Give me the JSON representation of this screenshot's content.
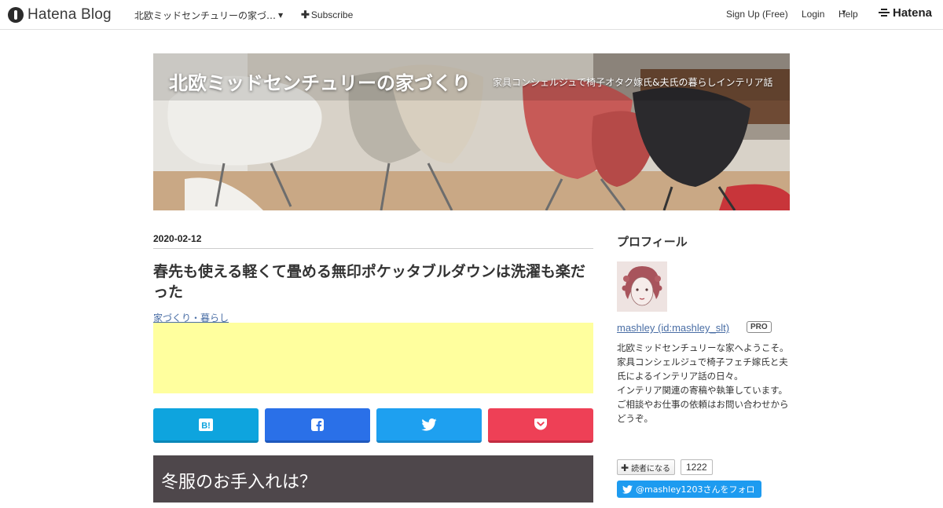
{
  "topbar": {
    "brand": "Hatena Blog",
    "blog_dropdown": "北欧ミッドセンチュリーの家づ…",
    "subscribe": "Subscribe",
    "sign_up": "Sign Up (Free)",
    "login": "Login",
    "help": "Help",
    "hatena": "Hatena"
  },
  "header": {
    "title": "北欧ミッドセンチュリーの家づくり",
    "description": "家具コンシェルジュで椅子オタク嫁氏&夫氏の暮らしインテリア話"
  },
  "entry": {
    "date": "2020-02-12",
    "title": "春先も使える軽くて畳める無印ポケッタブルダウンは洗濯も楽だった",
    "category": "家づくり・暮らし",
    "share_buttons": [
      {
        "name": "hatena-bookmark",
        "icon": "B!"
      },
      {
        "name": "facebook",
        "icon": "facebook-icon"
      },
      {
        "name": "twitter",
        "icon": "twitter-icon"
      },
      {
        "name": "pocket",
        "icon": "pocket-icon"
      }
    ],
    "section_heading": "冬服のお手入れは？"
  },
  "sidebar": {
    "title": "プロフィール",
    "profile_name": "mashley (id:mashley_slt)",
    "pro_badge": "PRO",
    "bio_lines": [
      "北欧ミッドセンチュリーな家へようこそ。",
      "家具コンシェルジュで椅子フェチ嫁氏と夫氏によるインテリア話の日々。",
      "インテリア関連の寄稿や執筆しています。",
      "ご相談やお仕事の依頼はお問い合わせからどうぞ。"
    ],
    "follow_label": "読者になる",
    "follow_count": "1222",
    "twitter_follow": "@mashley1203さんをフォロー"
  },
  "colors": {
    "hatena_share": "#0ea4de",
    "facebook_share": "#2a70e8",
    "twitter_share": "#1ea0f0",
    "pocket_share": "#ee4056",
    "ad_background": "#ffff9e",
    "section_heading_bg": "#4e474b",
    "link": "#4a6ea5"
  }
}
